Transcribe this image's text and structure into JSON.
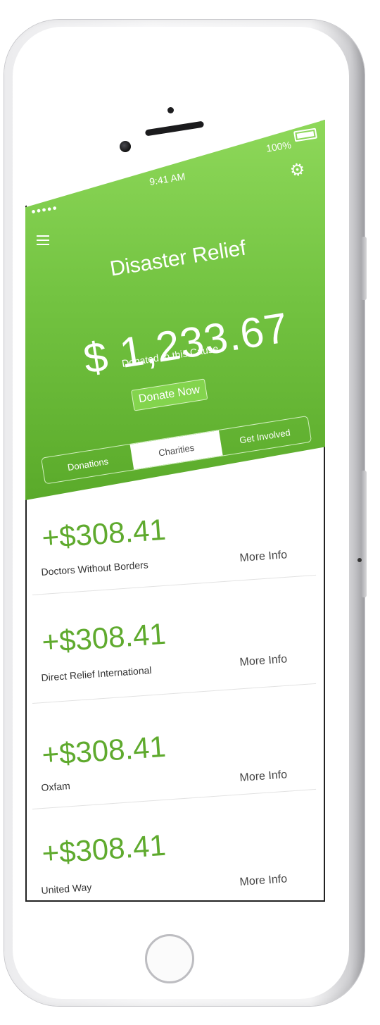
{
  "device": {
    "model": "iPhone"
  },
  "status_bar": {
    "time": "9:41 AM",
    "battery": "100%",
    "signal": "●●●●●"
  },
  "header": {
    "title": "Disaster Relief",
    "amount": "$ 1,233.67",
    "amount_caption": "Donated to this Cause",
    "donate_button": "Donate Now",
    "tabs": [
      {
        "label": "Donations",
        "active": false
      },
      {
        "label": "Charities",
        "active": true
      },
      {
        "label": "Get Involved",
        "active": false
      }
    ],
    "colors": {
      "top": "#8ed85a",
      "bottom": "#5aaa2a"
    }
  },
  "charities": [
    {
      "amount": "+$308.41",
      "name": "Doctors Without Borders",
      "link": "More Info"
    },
    {
      "amount": "+$308.41",
      "name": "Direct Relief International",
      "link": "More Info"
    },
    {
      "amount": "+$308.41",
      "name": "Oxfam",
      "link": "More Info"
    },
    {
      "amount": "+$308.41",
      "name": "United Way",
      "link": "More Info"
    }
  ],
  "colors": {
    "accent": "#5faa2e",
    "text": "#333333"
  }
}
